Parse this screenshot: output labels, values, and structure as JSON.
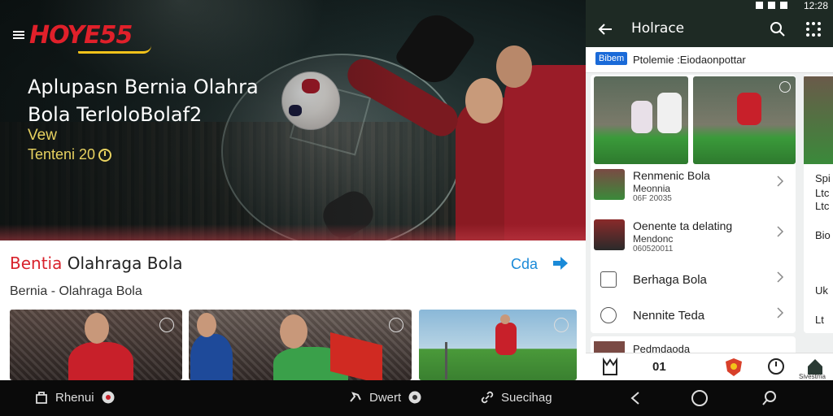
{
  "status_bar": {
    "time": "12:28"
  },
  "hero": {
    "logo": "HOYE55",
    "title_line1": "Aplupasn Bernia Olahra",
    "title_line2": "Bola TerloloBolaf2",
    "view_label": "Vew",
    "time_label": "Tenteni 20"
  },
  "section": {
    "title_first": "Bentia",
    "title_rest": " Olahraga Bola",
    "cta": "Cda",
    "subtitle": "Bernia  - Olahraga Bola"
  },
  "right_panel": {
    "app_title": "Holrace",
    "chip": "Bibem",
    "chip_text": "Ptolemie :Eiodaonpottar",
    "list": [
      {
        "title": "Renmenic Bola",
        "subtitle": "Meonnia",
        "meta": "06F 20035"
      },
      {
        "title": "Oenente ta delating",
        "subtitle": "Mendonc",
        "meta": "060520011"
      }
    ],
    "menu": [
      {
        "label": "Berhaga Bola"
      },
      {
        "label": "Nennite Teda"
      }
    ],
    "peek_row": "Pedmdaoda",
    "peek_col": {
      "t1": "Spi",
      "t2": "Ltc",
      "t3": "Ltc",
      "t4": "Bio",
      "t5": "Uk",
      "t6": "Lt"
    },
    "bottom_nav": {
      "label": "01",
      "home": "Sivestma"
    }
  },
  "system_nav": {
    "item1": "Rhenui",
    "item2": "Dwert",
    "item3": "Suecihag"
  },
  "colors": {
    "brand_red": "#e0202a",
    "brand_yellow": "#f2c21a",
    "accent_blue": "#1a8ad8",
    "appbar_dark": "#1e2a24"
  }
}
